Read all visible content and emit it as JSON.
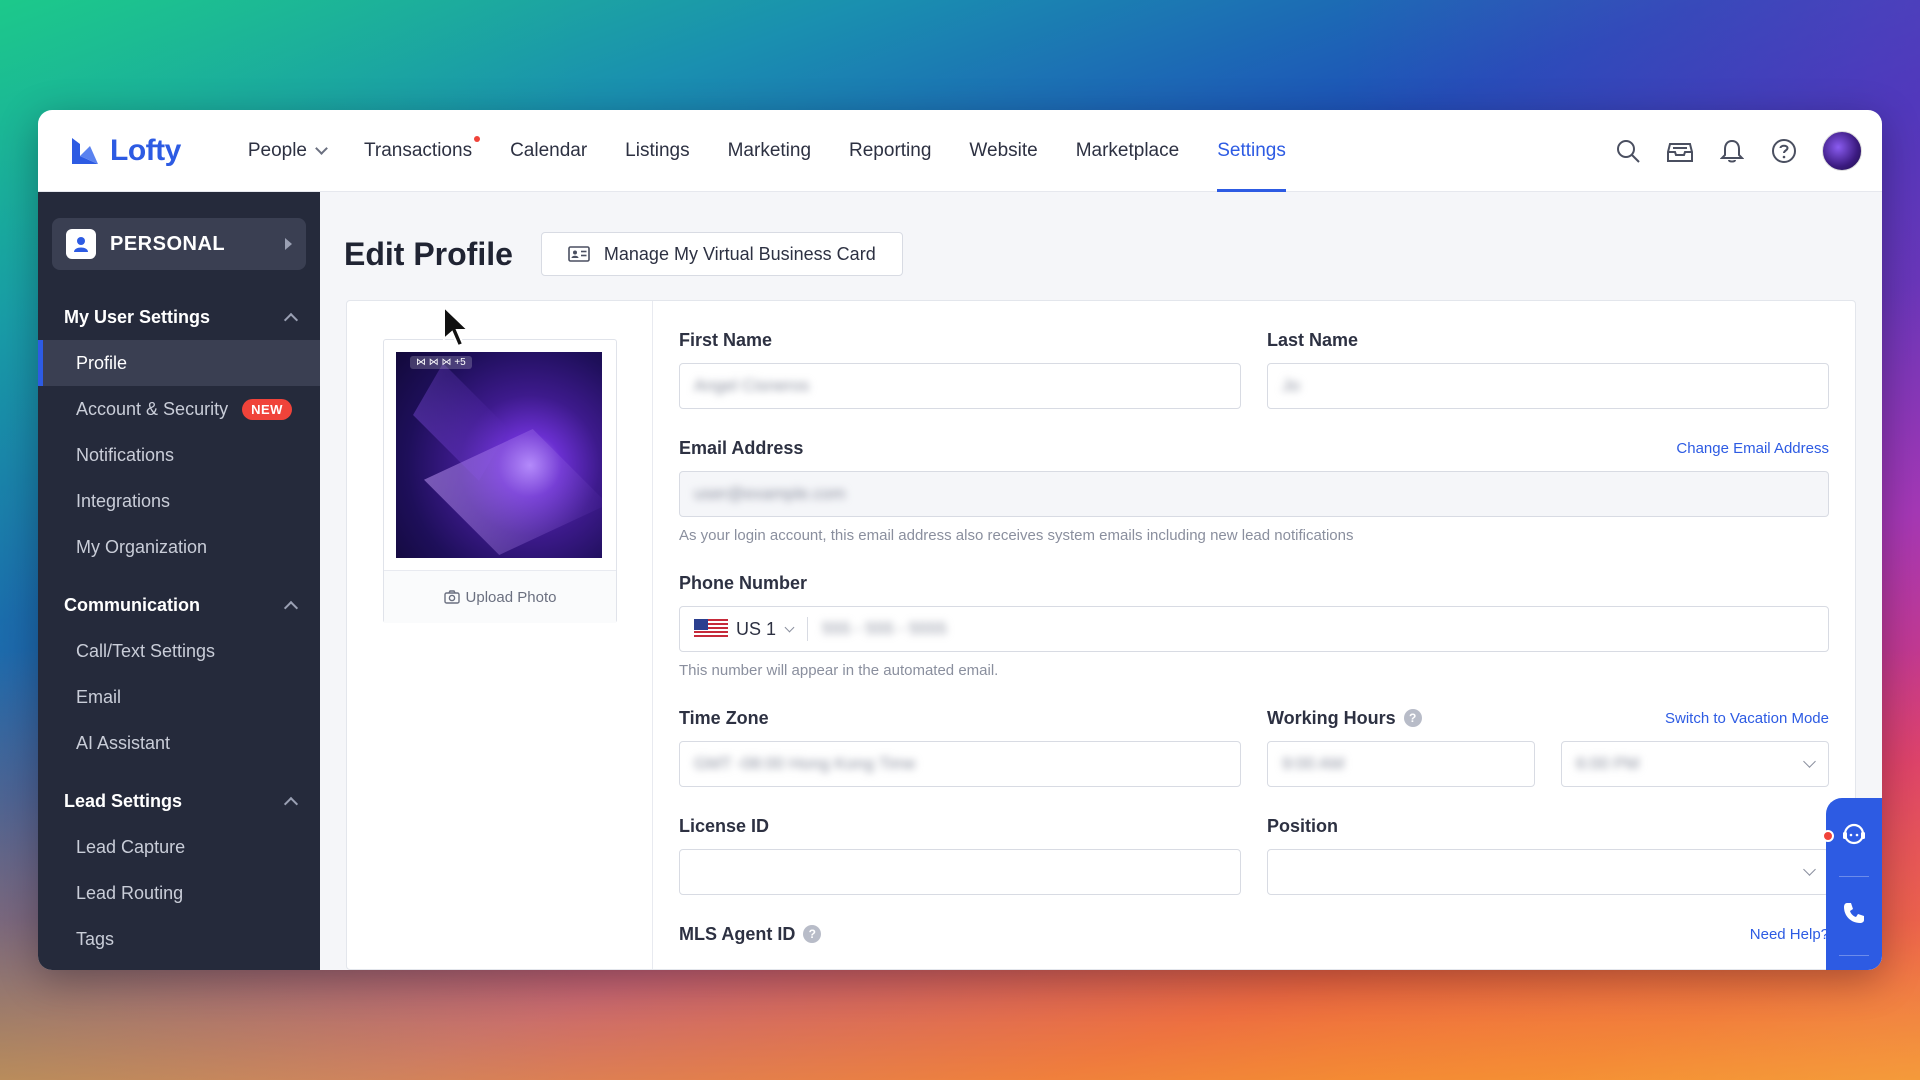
{
  "app": {
    "logo_text": "Lofty",
    "brand_color": "#2d5be3"
  },
  "nav": {
    "items": [
      {
        "label": "People",
        "dropdown": true
      },
      {
        "label": "Transactions",
        "dot": true
      },
      {
        "label": "Calendar"
      },
      {
        "label": "Listings"
      },
      {
        "label": "Marketing"
      },
      {
        "label": "Reporting"
      },
      {
        "label": "Website"
      },
      {
        "label": "Marketplace"
      },
      {
        "label": "Settings",
        "active": true
      }
    ],
    "right_icons": [
      "search-icon",
      "inbox-icon",
      "bell-icon",
      "help-icon",
      "avatar"
    ]
  },
  "sidebar": {
    "personal_label": "PERSONAL",
    "sections": [
      {
        "title": "My User Settings",
        "items": [
          {
            "label": "Profile",
            "active": true
          },
          {
            "label": "Account & Security",
            "badge": "NEW"
          },
          {
            "label": "Notifications"
          },
          {
            "label": "Integrations"
          },
          {
            "label": "My Organization"
          }
        ]
      },
      {
        "title": "Communication",
        "items": [
          {
            "label": "Call/Text Settings"
          },
          {
            "label": "Email"
          },
          {
            "label": "AI Assistant"
          }
        ]
      },
      {
        "title": "Lead Settings",
        "items": [
          {
            "label": "Lead Capture"
          },
          {
            "label": "Lead Routing"
          },
          {
            "label": "Tags"
          }
        ]
      }
    ]
  },
  "main": {
    "title": "Edit Profile",
    "vbc_button": "Manage My Virtual Business Card",
    "photo": {
      "tag": "⋈ ⋈ ⋈ +5",
      "upload_label": "Upload Photo"
    },
    "form": {
      "first_name": {
        "label": "First Name",
        "value": "Angel Cisneros"
      },
      "last_name": {
        "label": "Last Name",
        "value": "Jo"
      },
      "email": {
        "label": "Email Address",
        "link": "Change Email Address",
        "value": "user@example.com",
        "hint": "As your login account, this email address also receives system emails including new lead notifications"
      },
      "phone": {
        "label": "Phone Number",
        "country_code": "US 1",
        "value": "555 - 555 - 5555",
        "hint": "This number will appear in the automated email."
      },
      "timezone": {
        "label": "Time Zone",
        "value": "GMT -08:00 Hong Kong Time"
      },
      "working_hours": {
        "label": "Working Hours",
        "link": "Switch to Vacation Mode",
        "start": "9:00 AM",
        "end": "6:00 PM"
      },
      "license": {
        "label": "License ID",
        "value": ""
      },
      "position": {
        "label": "Position",
        "value": ""
      },
      "mls": {
        "label": "MLS Agent ID",
        "link": "Need Help?"
      }
    }
  }
}
